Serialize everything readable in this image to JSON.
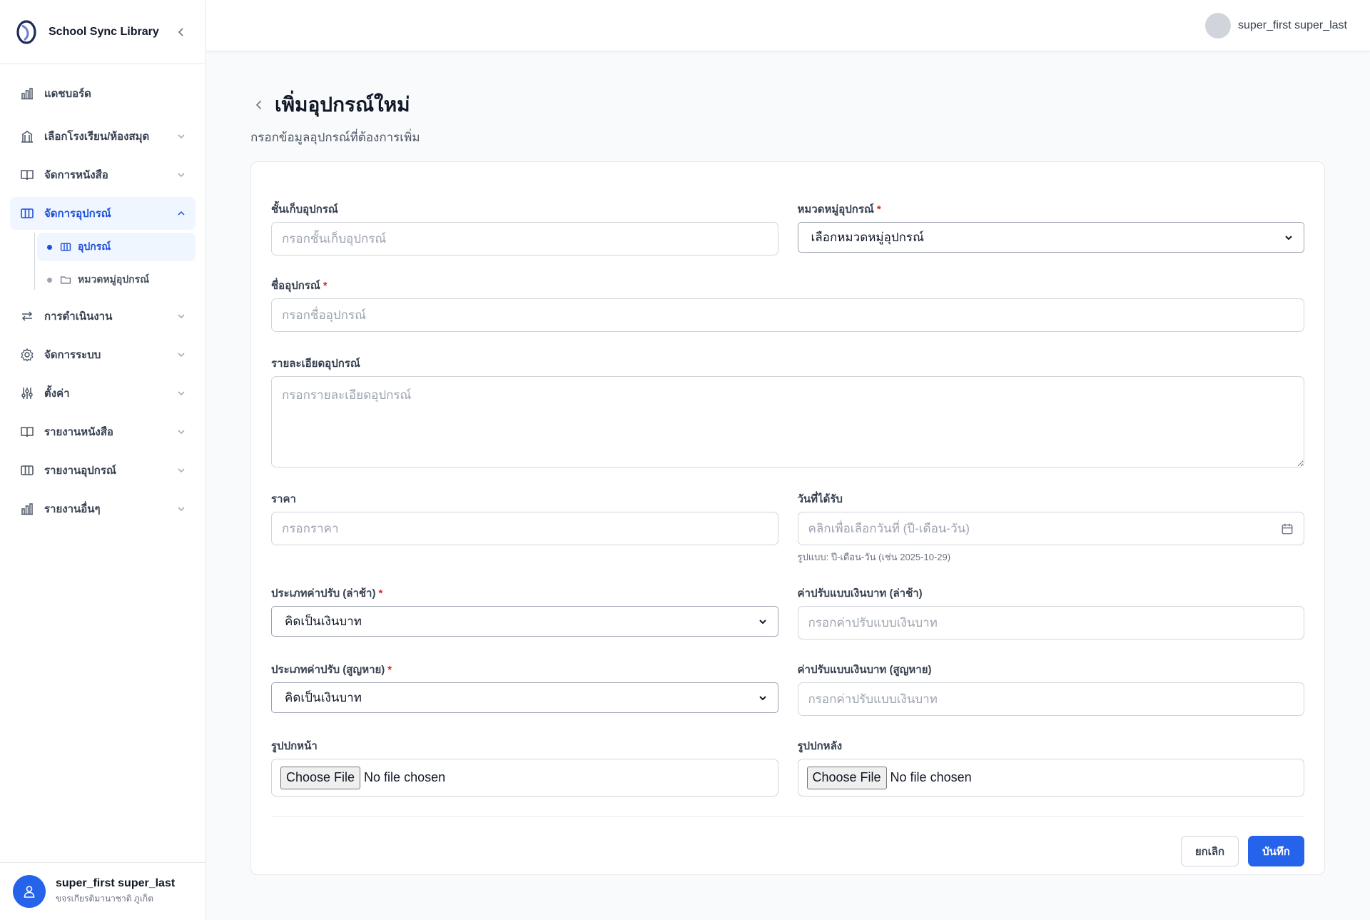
{
  "app": {
    "name": "School Sync Library"
  },
  "sidebar": {
    "items": [
      {
        "label": "แดชบอร์ด"
      },
      {
        "label": "เลือกโรงเรียน/ห้องสมุด"
      },
      {
        "label": "จัดการหนังสือ"
      },
      {
        "label": "จัดการอุปกรณ์"
      },
      {
        "label": "การดำเนินงาน"
      },
      {
        "label": "จัดการระบบ"
      },
      {
        "label": "ตั้งค่า"
      },
      {
        "label": "รายงานหนังสือ"
      },
      {
        "label": "รายงานอุปกรณ์"
      },
      {
        "label": "รายงานอื่นๆ"
      }
    ],
    "subitems": [
      {
        "label": "อุปกรณ์"
      },
      {
        "label": "หมวดหมู่อุปกรณ์"
      }
    ],
    "user": {
      "name": "super_first super_last",
      "school": "ขจรเกียรติมานาชาติ ภูเก็ต"
    }
  },
  "header": {
    "user_name": "super_first super_last"
  },
  "page": {
    "title": "เพิ่มอุปกรณ์ใหม่",
    "subtitle": "กรอกข้อมูลอุปกรณ์ที่ต้องการเพิ่ม"
  },
  "form": {
    "shelf": {
      "label": "ชั้นเก็บอุปกรณ์",
      "placeholder": "กรอกชั้นเก็บอุปกรณ์"
    },
    "category": {
      "label": "หมวดหมู่อุปกรณ์",
      "required": "*",
      "value": "เลือกหมวดหมู่อุปกรณ์"
    },
    "name": {
      "label": "ชื่ออุปกรณ์",
      "required": "*",
      "placeholder": "กรอกชื่ออุปกรณ์"
    },
    "detail": {
      "label": "รายละเอียดอุปกรณ์",
      "placeholder": "กรอกรายละเอียดอุปกรณ์"
    },
    "price": {
      "label": "ราคา",
      "placeholder": "กรอกราคา"
    },
    "received_date": {
      "label": "วันที่ได้รับ",
      "placeholder": "คลิกเพื่อเลือกวันที่ (ปี-เดือน-วัน)",
      "hint": "รูปแบบ: ปี-เดือน-วัน (เช่น 2025-10-29)"
    },
    "late_fine_type": {
      "label": "ประเภทค่าปรับ (ล่าช้า)",
      "required": "*",
      "value": "คิดเป็นเงินบาท"
    },
    "late_fine_amount": {
      "label": "ค่าปรับแบบเงินบาท (ล่าช้า)",
      "placeholder": "กรอกค่าปรับแบบเงินบาท"
    },
    "lost_fine_type": {
      "label": "ประเภทค่าปรับ (สูญหาย)",
      "required": "*",
      "value": "คิดเป็นเงินบาท"
    },
    "lost_fine_amount": {
      "label": "ค่าปรับแบบเงินบาท (สูญหาย)",
      "placeholder": "กรอกค่าปรับแบบเงินบาท"
    },
    "front_cover": {
      "label": "รูปปกหน้า",
      "button": "Choose File",
      "status": "No file chosen"
    },
    "back_cover": {
      "label": "รูปปกหลัง",
      "button": "Choose File",
      "status": "No file chosen"
    }
  },
  "actions": {
    "cancel": "ยกเลิก",
    "save": "บันทึก"
  },
  "colors": {
    "accent": "#2563eb",
    "active_bg": "#eff6ff",
    "required": "#dc2626"
  }
}
